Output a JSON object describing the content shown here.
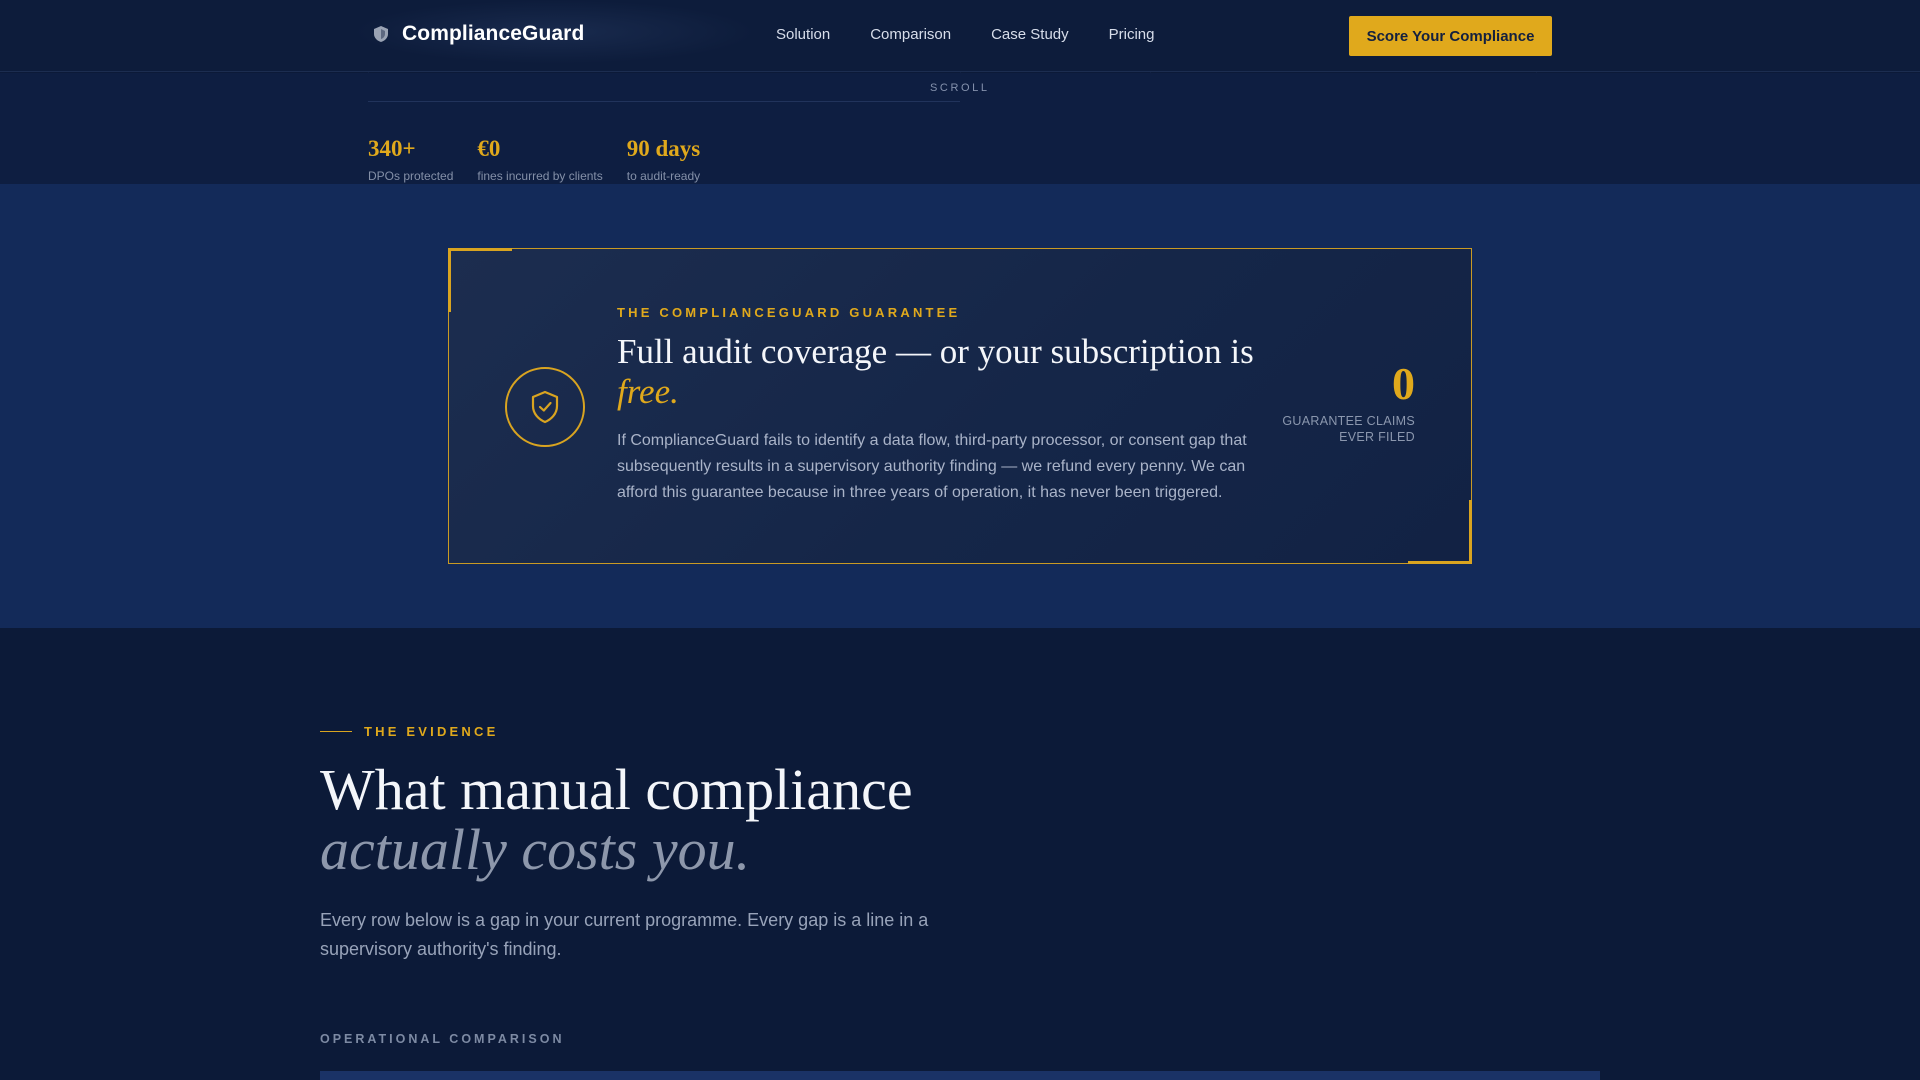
{
  "nav": {
    "brand": "ComplianceGuard",
    "links": [
      "Solution",
      "Comparison",
      "Case Study",
      "Pricing"
    ],
    "cta": "Score Your Compliance"
  },
  "hero": {
    "scroll_label": "SCROLL",
    "stats": [
      {
        "value": "340+",
        "label": "DPOs protected"
      },
      {
        "value": "€0",
        "label": "fines incurred by clients"
      },
      {
        "value": "90 days",
        "label": "to audit-ready"
      }
    ]
  },
  "guarantee": {
    "eyebrow": "THE COMPLIANCEGUARD GUARANTEE",
    "title_main": "Full audit coverage — or your subscription is ",
    "title_em": "free.",
    "text": "If ComplianceGuard fails to identify a data flow, third-party processor, or consent gap that subsequently results in a supervisory authority finding — we refund every penny. We can afford this guarantee because in three years of operation, it has never been triggered.",
    "claims_value": "0",
    "claims_label_1": "GUARANTEE CLAIMS",
    "claims_label_2": "EVER FILED"
  },
  "evidence": {
    "eyebrow": "THE EVIDENCE",
    "title_main": "What manual compliance",
    "title_em": "actually costs you.",
    "text": "Every row below is a gap in your current programme. Every gap is a line in a supervisory authority's finding.",
    "op_label": "OPERATIONAL COMPARISON"
  },
  "colors": {
    "accent": "#e0a91c",
    "background": "#0c1a38",
    "band": "#132a59"
  },
  "icons": {
    "brand": "shield-logo-icon",
    "guarantee": "shield-check-icon"
  }
}
